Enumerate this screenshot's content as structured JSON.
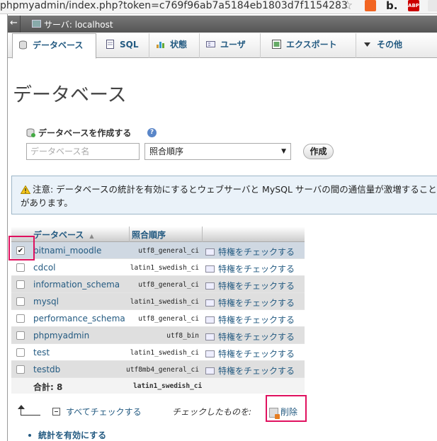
{
  "browser": {
    "url": "phpmyadmin/index.php?token=c769f96ab7a5184eb1803d7f1154283",
    "ext_b": "b.",
    "ext_abp": "ABP"
  },
  "breadcrumb": {
    "back": "←",
    "server_label": "サーバ: localhost"
  },
  "tabs": [
    {
      "label": "データベース",
      "icon": "database-icon",
      "active": true
    },
    {
      "label": "SQL",
      "icon": "sql-icon"
    },
    {
      "label": "状態",
      "icon": "status-icon"
    },
    {
      "label": "ユーザ",
      "icon": "users-icon"
    },
    {
      "label": "エクスポート",
      "icon": "export-icon"
    },
    {
      "label": "その他",
      "icon": "chevron-down-icon"
    }
  ],
  "page_title": "データベース",
  "create": {
    "heading": "データベースを作成する",
    "name_placeholder": "データベース名",
    "collation_value": "照合順序",
    "button": "作成"
  },
  "notice": "注意: データベースの統計を有効にするとウェブサーバと MySQL サーバの間の通信量が激増することがあります。",
  "table": {
    "headers": {
      "database": "データベース",
      "collation": "照合順序"
    },
    "rows": [
      {
        "name": "bitnami_moodle",
        "collation": "utf8_general_ci",
        "priv": "特権をチェックする",
        "checked": true
      },
      {
        "name": "cdcol",
        "collation": "latin1_swedish_ci",
        "priv": "特権をチェックする",
        "checked": false
      },
      {
        "name": "information_schema",
        "collation": "utf8_general_ci",
        "priv": "特権をチェックする",
        "checked": false
      },
      {
        "name": "mysql",
        "collation": "latin1_swedish_ci",
        "priv": "特権をチェックする",
        "checked": false
      },
      {
        "name": "performance_schema",
        "collation": "utf8_general_ci",
        "priv": "特権をチェックする",
        "checked": false
      },
      {
        "name": "phpmyadmin",
        "collation": "utf8_bin",
        "priv": "特権をチェックする",
        "checked": false
      },
      {
        "name": "test",
        "collation": "latin1_swedish_ci",
        "priv": "特権をチェックする",
        "checked": false
      },
      {
        "name": "testdb",
        "collation": "utf8mb4_general_ci",
        "priv": "特権をチェックする",
        "checked": false
      }
    ],
    "total_label": "合計: 8",
    "total_collation": "latin1_swedish_ci"
  },
  "footer": {
    "check_all": "すべてチェックする",
    "with_selected": "チェックしたものを:",
    "delete": "削除"
  },
  "enable_stats": "統計を有効にする"
}
